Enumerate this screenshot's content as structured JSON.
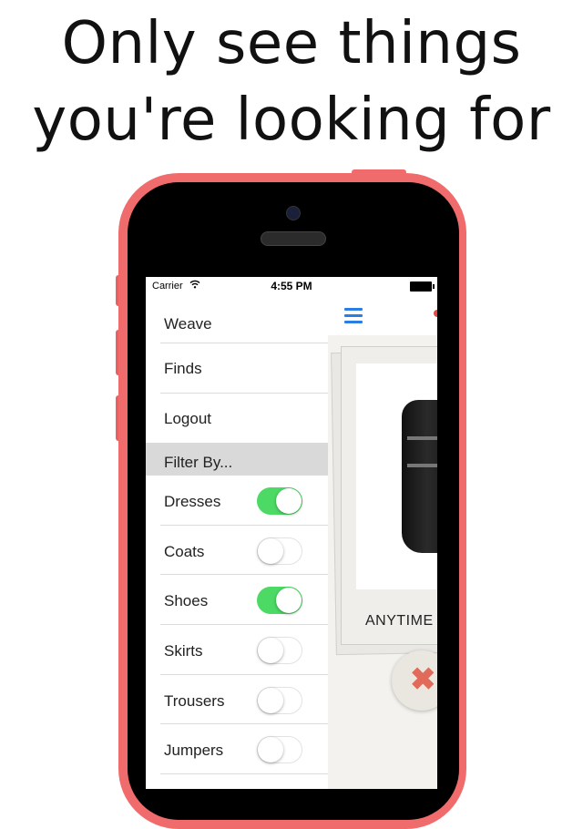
{
  "headline": {
    "line1": "Only see things",
    "line2": "you're looking for"
  },
  "status_bar": {
    "carrier": "Carrier",
    "time": "4:55 PM"
  },
  "menu": {
    "items": [
      {
        "label": "Weave"
      },
      {
        "label": "Finds"
      },
      {
        "label": "Logout"
      }
    ],
    "filter_header": "Filter By...",
    "filters": [
      {
        "label": "Dresses",
        "on": true
      },
      {
        "label": "Coats",
        "on": false
      },
      {
        "label": "Shoes",
        "on": true
      },
      {
        "label": "Skirts",
        "on": false
      },
      {
        "label": "Trousers",
        "on": false
      },
      {
        "label": "Jumpers",
        "on": false
      }
    ]
  },
  "card": {
    "title": "ANYTIME"
  },
  "colors": {
    "phone": "#f06b6b",
    "toggle_on": "#4cd964",
    "accent": "#2a7de1",
    "reject": "#e26a5a"
  }
}
